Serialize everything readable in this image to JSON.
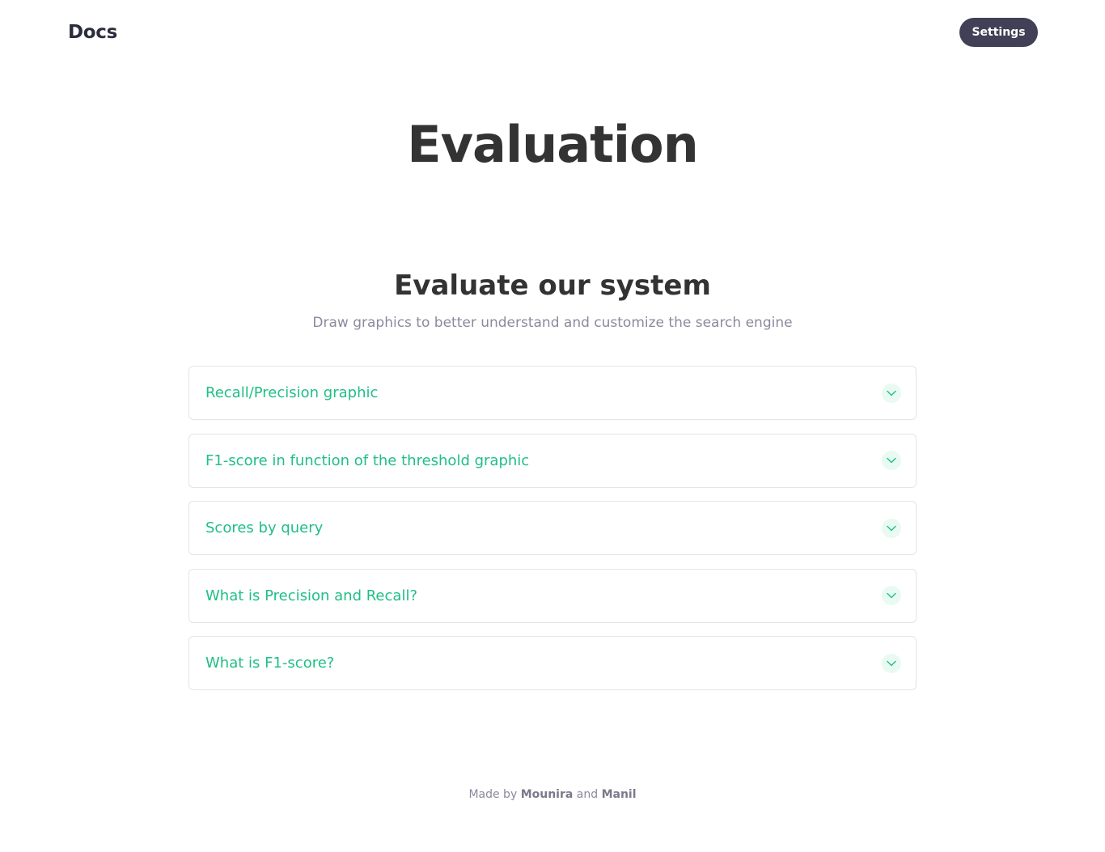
{
  "header": {
    "logo": "Docs",
    "settings_label": "Settings"
  },
  "page": {
    "title": "Evaluation"
  },
  "section": {
    "title": "Evaluate our system",
    "subtitle": "Draw graphics to better understand and customize the search engine"
  },
  "accordion": {
    "items": [
      {
        "label": "Recall/Precision graphic",
        "icon": "chevron-down-icon"
      },
      {
        "label": "F1-score in function of the threshold graphic",
        "icon": "chevron-down-icon"
      },
      {
        "label": "Scores by query",
        "icon": "chevron-down-icon"
      },
      {
        "label": "What is Precision and Recall?",
        "icon": "chevron-down-icon"
      },
      {
        "label": "What is F1-score?",
        "icon": "chevron-down-icon"
      }
    ]
  },
  "footer": {
    "prefix": "Made by",
    "author1": "Mounira",
    "conjunction": "and",
    "author2": "Manil"
  },
  "colors": {
    "accent": "#1fbf85",
    "button_bg": "#424057",
    "heading": "#333333",
    "muted": "#8a8a9e"
  }
}
